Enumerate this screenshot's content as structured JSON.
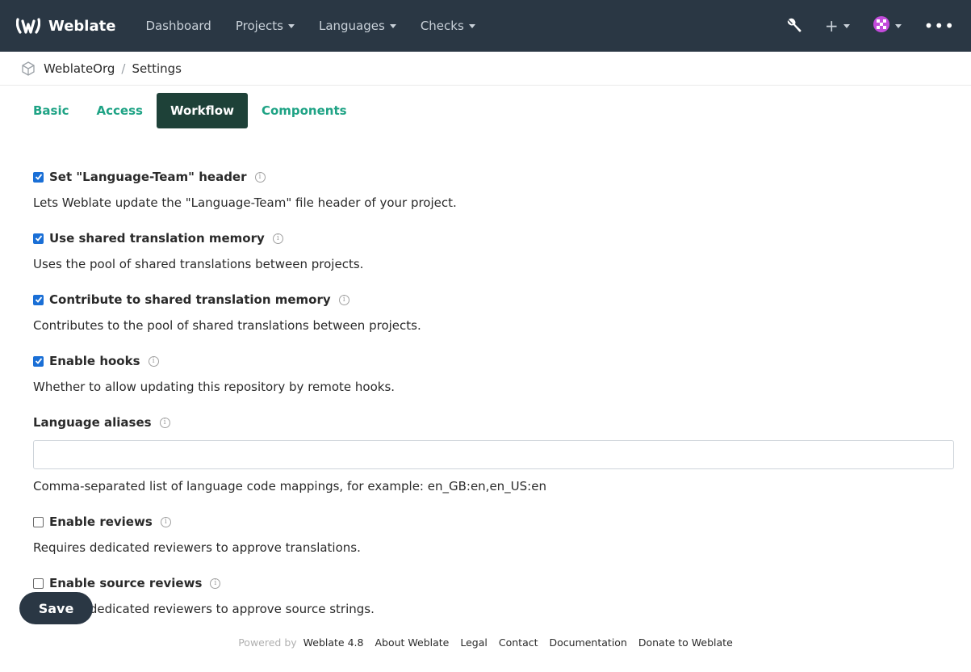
{
  "navbar": {
    "brand": "Weblate",
    "items": [
      {
        "label": "Dashboard",
        "dropdown": false
      },
      {
        "label": "Projects",
        "dropdown": true
      },
      {
        "label": "Languages",
        "dropdown": true
      },
      {
        "label": "Checks",
        "dropdown": true
      }
    ],
    "icons": [
      "wrench-icon",
      "plus-icon",
      "avatar",
      "more-icon"
    ],
    "plus": "+",
    "more": "•••"
  },
  "breadcrumb": {
    "project": "WeblateOrg",
    "separator": "/",
    "page": "Settings"
  },
  "tabs": [
    {
      "label": "Basic",
      "active": false
    },
    {
      "label": "Access",
      "active": false
    },
    {
      "label": "Workflow",
      "active": true
    },
    {
      "label": "Components",
      "active": false
    }
  ],
  "form": {
    "language_team": {
      "label": "Set \"Language-Team\" header",
      "help": "Lets Weblate update the \"Language-Team\" file header of your project.",
      "checked": true
    },
    "use_shared_tm": {
      "label": "Use shared translation memory",
      "help": "Uses the pool of shared translations between projects.",
      "checked": true
    },
    "contribute_shared_tm": {
      "label": "Contribute to shared translation memory",
      "help": "Contributes to the pool of shared translations between projects.",
      "checked": true
    },
    "enable_hooks": {
      "label": "Enable hooks",
      "help": "Whether to allow updating this repository by remote hooks.",
      "checked": true
    },
    "language_aliases": {
      "label": "Language aliases",
      "value": "",
      "help": "Comma-separated list of language code mappings, for example: en_GB:en,en_US:en"
    },
    "enable_reviews": {
      "label": "Enable reviews",
      "help": "Requires dedicated reviewers to approve translations.",
      "checked": false
    },
    "enable_source_reviews": {
      "label": "Enable source reviews",
      "help": "Requires dedicated reviewers to approve source strings.",
      "checked": false
    },
    "info_glyph": "i"
  },
  "save_label": "Save",
  "footer": {
    "powered_by": "Powered by",
    "version": "Weblate 4.8",
    "links": [
      "About Weblate",
      "Legal",
      "Contact",
      "Documentation",
      "Donate to Weblate"
    ]
  },
  "colors": {
    "navbar_bg": "#2a3744",
    "accent": "#1fa385",
    "active_tab_bg": "#1e4138",
    "checkbox_checked": "#1a6fd6"
  }
}
